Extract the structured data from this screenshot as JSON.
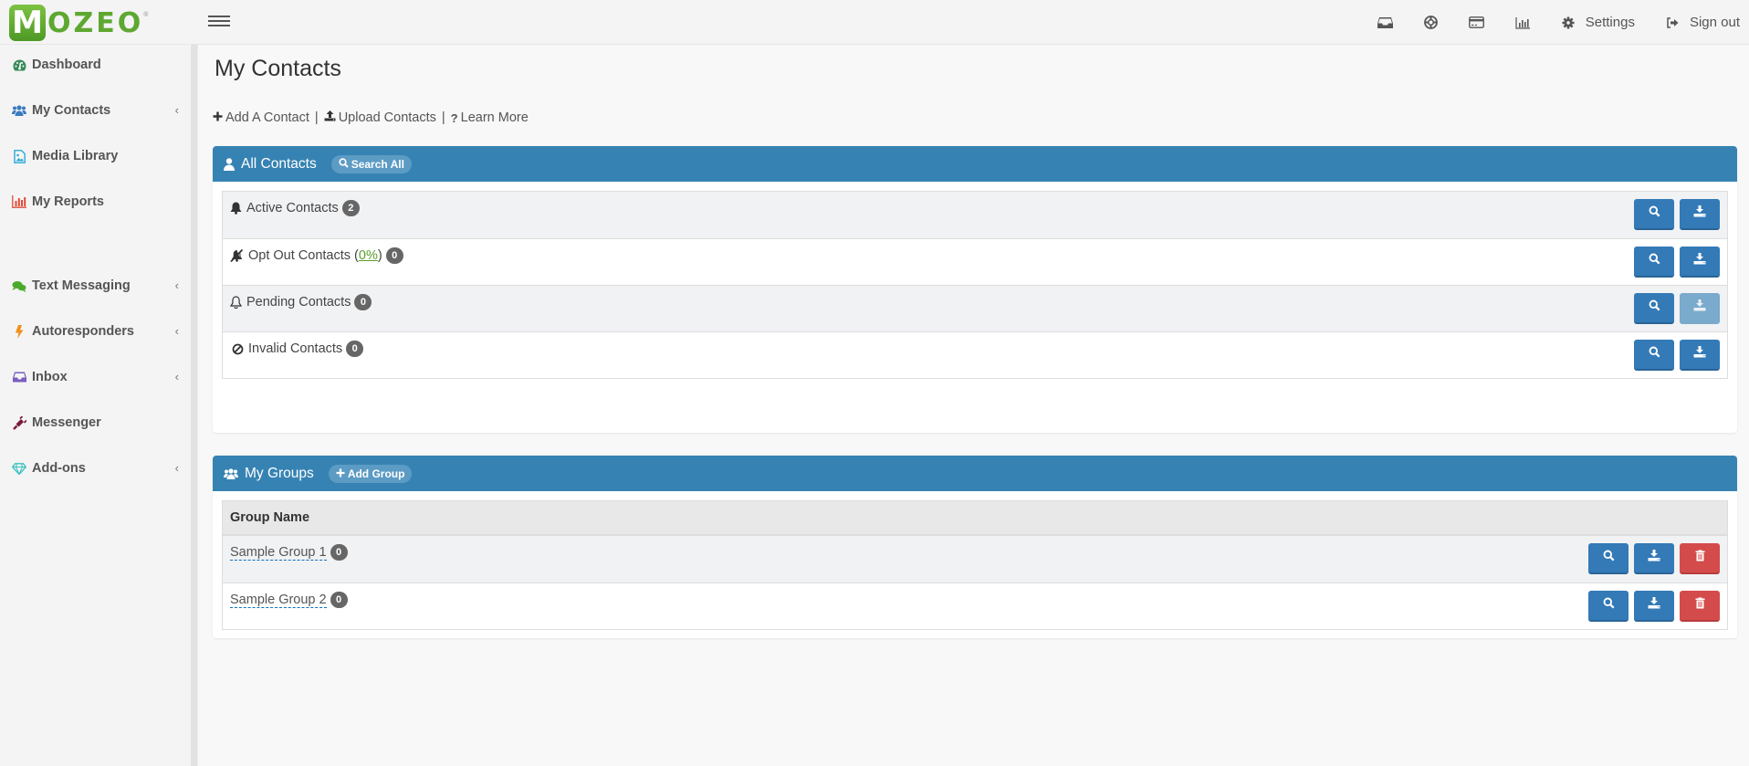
{
  "brand": {
    "logo_first": "M",
    "logo_rest": "OZEO",
    "registered": "®",
    "accent": "#5ea832"
  },
  "topnav": {
    "icons": [
      {
        "name": "inbox-icon"
      },
      {
        "name": "support-icon"
      },
      {
        "name": "billing-icon"
      },
      {
        "name": "reports-icon"
      }
    ],
    "settings_label": "Settings",
    "signout_label": "Sign out"
  },
  "sidebar": {
    "items": [
      {
        "label": "Dashboard",
        "icon": "dashboard-icon",
        "color": "#3a8a5a",
        "expandable": false
      },
      {
        "label": "My Contacts",
        "icon": "users-icon",
        "color": "#3a7bbf",
        "expandable": true
      },
      {
        "label": "Media Library",
        "icon": "image-file-icon",
        "color": "#2aa8d8",
        "expandable": false
      },
      {
        "label": "My Reports",
        "icon": "bar-chart-icon",
        "color": "#e04a3a",
        "expandable": false
      },
      {
        "label": "Text Messaging",
        "icon": "chat-icon",
        "color": "#4caa2a",
        "expandable": true
      },
      {
        "label": "Autoresponders",
        "icon": "bolt-icon",
        "color": "#f0901a",
        "expandable": true
      },
      {
        "label": "Inbox",
        "icon": "inbox-icon",
        "color": "#7a5ec0",
        "expandable": true
      },
      {
        "label": "Messenger",
        "icon": "plug-icon",
        "color": "#7a1a3a",
        "expandable": false
      },
      {
        "label": "Add-ons",
        "icon": "diamond-icon",
        "color": "#3ac0c0",
        "expandable": true
      }
    ]
  },
  "page": {
    "title": "My Contacts",
    "links": {
      "add_contact": "Add A Contact",
      "upload_contacts": "Upload Contacts",
      "learn_more": "Learn More",
      "separator": "|"
    }
  },
  "all_contacts": {
    "title": "All Contacts",
    "search_all_label": "Search All",
    "header_color": "#3683b3",
    "rows": [
      {
        "label": "Active Contacts",
        "icon": "bell-icon",
        "count": "2",
        "download_enabled": true
      },
      {
        "label": "Opt Out Contacts (",
        "pct": "0%",
        "label_suffix": ")",
        "icon": "bell-slash-icon",
        "count": "0",
        "download_enabled": true
      },
      {
        "label": "Pending Contacts",
        "icon": "bell-outline-icon",
        "count": "0",
        "download_enabled": false
      },
      {
        "label": "Invalid Contacts",
        "icon": "ban-icon",
        "count": "0",
        "download_enabled": true
      }
    ]
  },
  "my_groups": {
    "title": "My Groups",
    "add_group_label": "Add Group",
    "column_header": "Group Name",
    "rows": [
      {
        "name": "Sample Group 1",
        "count": "0"
      },
      {
        "name": "Sample Group 2",
        "count": "0"
      }
    ]
  }
}
